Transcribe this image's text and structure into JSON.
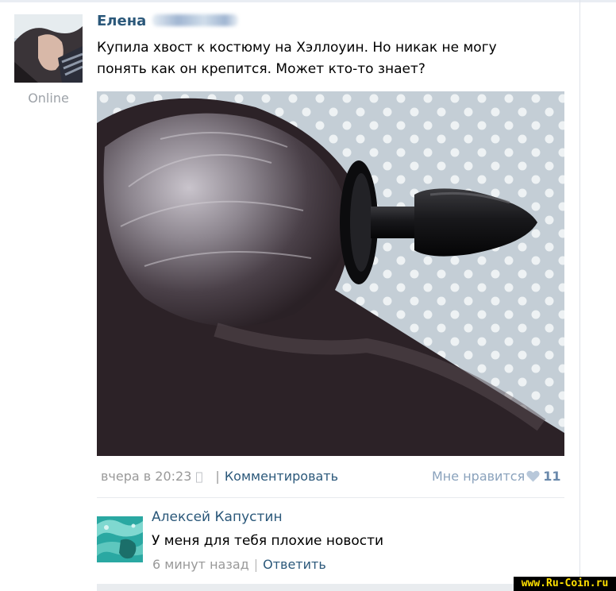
{
  "post": {
    "author_first_name": "Елена",
    "status": "Online",
    "text_line1": "Купила хвост к костюму на Хэллоуин. Но никак не могу",
    "text_line2": "понять как он крепится. Может кто-то знает?",
    "timestamp": "вчера в 20:23",
    "device_icon": "apple-icon",
    "separator": "|",
    "comment_action": "Комментировать",
    "like_label": "Мне нравится",
    "like_count": "11"
  },
  "comment": {
    "author": "Алексей Капустин",
    "text": "У меня для тебя плохие новости",
    "time": "6 минут назад",
    "separator": "|",
    "reply_label": "Ответить"
  },
  "watermark": "www.Ru-Coin.ru",
  "colors": {
    "link": "#2b587a",
    "meta": "#999999",
    "like_heart": "#b8c8da"
  }
}
